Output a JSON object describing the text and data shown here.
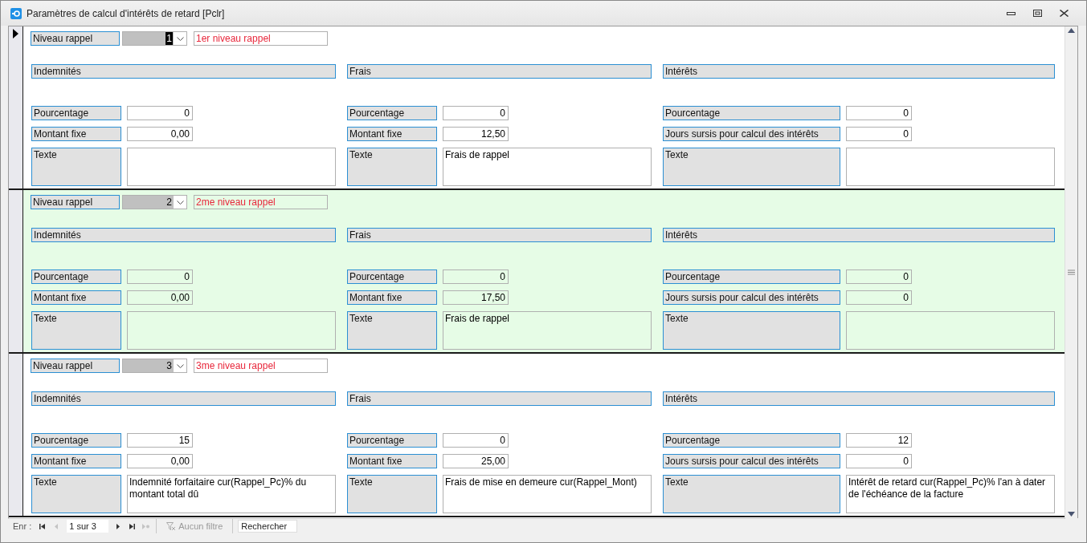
{
  "window": {
    "title": "Paramètres de calcul d'intérêts de retard [Pclr]"
  },
  "records": [
    {
      "selected": true,
      "niveau": {
        "label": "Niveau rappel",
        "value": "1",
        "description": "1er niveau rappel"
      },
      "sections": [
        {
          "header": "Indemnités",
          "rows": [
            {
              "label": "Pourcentage",
              "value": "0"
            },
            {
              "label": "Montant fixe",
              "value": "0,00"
            }
          ],
          "text_label": "Texte"
        },
        {
          "header": "Frais",
          "rows": [
            {
              "label": "Pourcentage",
              "value": "0"
            },
            {
              "label": "Montant fixe",
              "value": "12,50"
            }
          ],
          "text_label": "Texte",
          "text": "Frais de rappel"
        },
        {
          "header": "Intérêts",
          "rows": [
            {
              "label": "Pourcentage",
              "value": "0"
            },
            {
              "label": "Jours sursis pour calcul des intérêts",
              "value": "0"
            }
          ],
          "text_label": "Texte"
        }
      ]
    },
    {
      "selected": false,
      "niveau": {
        "label": "Niveau rappel",
        "value": "2",
        "description": "2me niveau rappel"
      },
      "sections": [
        {
          "header": "Indemnités",
          "rows": [
            {
              "label": "Pourcentage",
              "value": "0"
            },
            {
              "label": "Montant fixe",
              "value": "0,00"
            }
          ],
          "text_label": "Texte"
        },
        {
          "header": "Frais",
          "rows": [
            {
              "label": "Pourcentage",
              "value": "0"
            },
            {
              "label": "Montant fixe",
              "value": "17,50"
            }
          ],
          "text_label": "Texte",
          "text": "Frais de rappel"
        },
        {
          "header": "Intérêts",
          "rows": [
            {
              "label": "Pourcentage",
              "value": "0"
            },
            {
              "label": "Jours sursis pour calcul des intérêts",
              "value": "0"
            }
          ],
          "text_label": "Texte"
        }
      ]
    },
    {
      "selected": false,
      "niveau": {
        "label": "Niveau rappel",
        "value": "3",
        "description": "3me niveau rappel"
      },
      "sections": [
        {
          "header": "Indemnités",
          "rows": [
            {
              "label": "Pourcentage",
              "value": "15"
            },
            {
              "label": "Montant fixe",
              "value": "0,00"
            }
          ],
          "text_label": "Texte",
          "text": "Indemnité forfaitaire cur(Rappel_Pc)% du montant total dû"
        },
        {
          "header": "Frais",
          "rows": [
            {
              "label": "Pourcentage",
              "value": "0"
            },
            {
              "label": "Montant fixe",
              "value": "25,00"
            }
          ],
          "text_label": "Texte",
          "text": "Frais de mise en demeure cur(Rappel_Mont)"
        },
        {
          "header": "Intérêts",
          "rows": [
            {
              "label": "Pourcentage",
              "value": "12"
            },
            {
              "label": "Jours sursis pour calcul des intérêts",
              "value": "0"
            }
          ],
          "text_label": "Texte",
          "text": "Intérêt de retard cur(Rappel_Pc)% l'an à dater de l'échéance de la facture"
        }
      ]
    }
  ],
  "navigation": {
    "label": "Enr :",
    "position": "1 sur 3",
    "buttons": [
      {
        "kind": "first",
        "disabled": false
      },
      {
        "kind": "previous",
        "disabled": true
      },
      {
        "kind": "next",
        "disabled": false
      },
      {
        "kind": "last",
        "disabled": false
      },
      {
        "kind": "new",
        "disabled": true
      }
    ],
    "filter": {
      "label": "Aucun filtre",
      "disabled": true
    },
    "search": {
      "placeholder": "Rechercher"
    }
  }
}
